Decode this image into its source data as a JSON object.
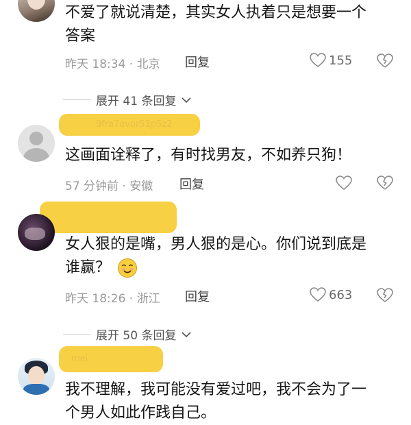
{
  "comments": [
    {
      "text_line1": "不爱了就说清楚，其实女人执着只是想要一个",
      "text_line2": "答案",
      "meta": "昨天 18:34 · 北京",
      "reply": "回复",
      "likes": "155"
    },
    {
      "text": "这画面诠释了，有时找男友，不如养只狗！",
      "meta": "57 分钟前 · 安徽",
      "reply": "回复",
      "faint_username": "9fra7ovor51p5z2"
    },
    {
      "text_line1": "女人狠的是嘴，男人狠的是心。你们说到底是",
      "text_line2": "谁赢？",
      "meta": "昨天 18:26 · 浙江",
      "reply": "回复",
      "likes": "663"
    },
    {
      "text_line1": "我不理解，我可能没有爱过吧，我不会为了一",
      "text_line2": "个男人如此作践自己。",
      "faint_username": "mei"
    }
  ],
  "expanders": [
    {
      "label": "展开 41 条回复"
    },
    {
      "label": "展开 50 条回复"
    }
  ],
  "colors": {
    "highlight": "#f8cd3a",
    "meta": "#9a9a9a"
  }
}
